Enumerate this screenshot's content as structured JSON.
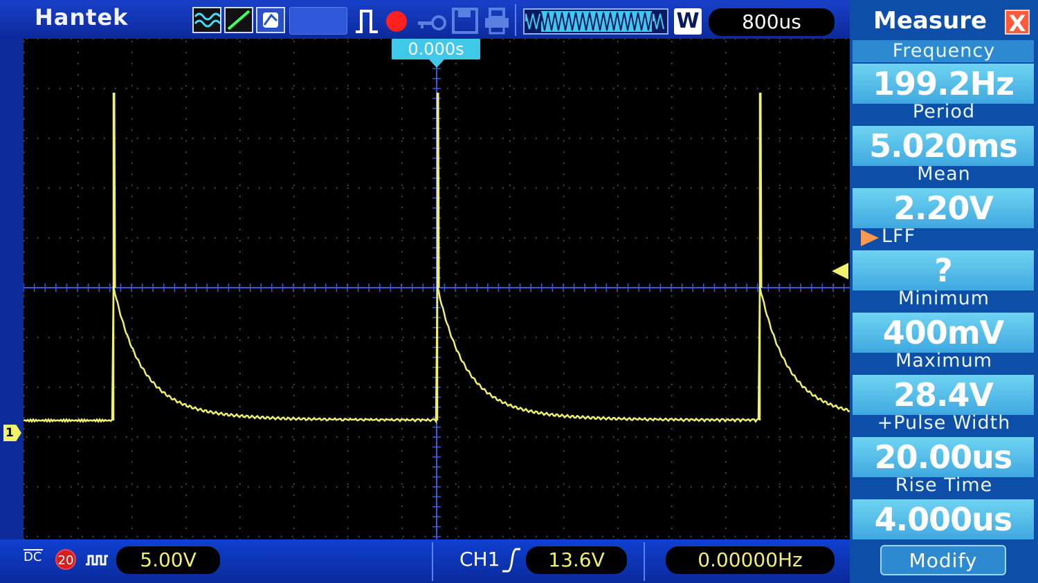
{
  "header": {
    "brand": "Hantek",
    "timebase": "800us",
    "window_mode": "W",
    "trigger_time": "0.000s"
  },
  "channel": {
    "marker": "1",
    "coupling": "DC",
    "bw_limit": "20",
    "volts_per_div": "5.00V"
  },
  "trigger": {
    "source": "CH1",
    "level": "13.6V",
    "frequency": "0.00000Hz"
  },
  "measure": {
    "title": "Measure",
    "close": "X",
    "items": [
      {
        "label": "Frequency",
        "value": "199.2Hz"
      },
      {
        "label": "Period",
        "value": "5.020ms"
      },
      {
        "label": "Mean",
        "value": "2.20V"
      },
      {
        "label": "LFF",
        "value": "?"
      },
      {
        "label": "Minimum",
        "value": "400mV"
      },
      {
        "label": "Maximum",
        "value": "28.4V"
      },
      {
        "label": "+Pulse Width",
        "value": "20.00us"
      },
      {
        "label": "Rise Time",
        "value": "4.000us"
      }
    ],
    "modify": "Modify"
  },
  "colors": {
    "trace": "#f0f06a",
    "grid": "#3c5ad8",
    "panel_value": "#5cc4ee"
  },
  "icons": [
    "waveform-icon",
    "slope-icon",
    "persist-icon",
    "pulse-trigger-icon",
    "record-icon",
    "key-icon",
    "save-icon",
    "print-icon",
    "coupling-ac-icon"
  ]
}
